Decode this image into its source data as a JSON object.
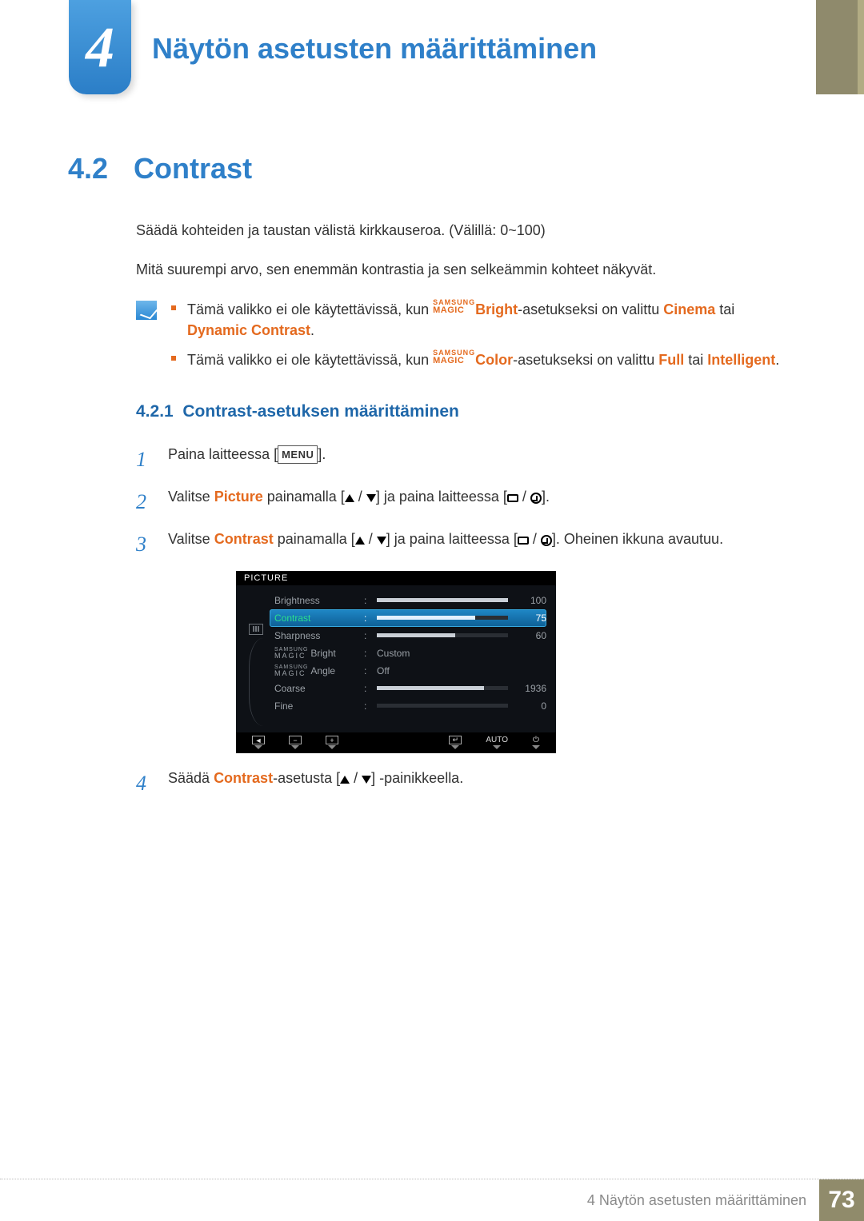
{
  "chapter": {
    "number": "4",
    "title": "Näytön asetusten määrittäminen"
  },
  "section": {
    "number": "4.2",
    "title": "Contrast"
  },
  "paragraphs": {
    "p1": "Säädä kohteiden ja taustan välistä kirkkauseroa. (Välillä: 0~100)",
    "p2": "Mitä suurempi arvo, sen enemmän kontrastia ja sen selkeämmin kohteet näkyvät."
  },
  "note": {
    "item1": {
      "pre": "Tämä valikko ei ole käytettävissä, kun ",
      "magic_top": "SAMSUNG",
      "magic_bottom": "MAGIC",
      "feature": "Bright",
      "mid": "-asetukseksi on valittu ",
      "opt1": "Cinema",
      "between": " tai ",
      "opt2": "Dynamic Contrast",
      "post": "."
    },
    "item2": {
      "pre": "Tämä valikko ei ole käytettävissä, kun ",
      "magic_top": "SAMSUNG",
      "magic_bottom": "MAGIC",
      "feature": "Color",
      "mid": "-asetukseksi on valittu ",
      "opt1": "Full",
      "between": " tai ",
      "opt2": "Intelligent",
      "post": "."
    }
  },
  "subsection": {
    "number": "4.2.1",
    "title": "Contrast-asetuksen määrittäminen"
  },
  "steps": {
    "s1": {
      "t1": "Paina laitteessa [",
      "menu": "MENU",
      "t2": "]."
    },
    "s2": {
      "t1": "Valitse ",
      "kw": "Picture",
      "t2": " painamalla [",
      "t3": "] ja paina laitteessa [",
      "t4": "]."
    },
    "s3": {
      "t1": "Valitse ",
      "kw": "Contrast",
      "t2": " painamalla [",
      "t3": "] ja paina laitteessa [",
      "t4": "]. Oheinen ikkuna avautuu."
    },
    "s4": {
      "t1": "Säädä ",
      "kw": "Contrast",
      "t2": "-asetusta [",
      "t3": "] -painikkeella."
    }
  },
  "osd": {
    "header": "PICTURE",
    "rows": {
      "brightness": {
        "label": "Brightness",
        "value": "100",
        "fill_pct": 100
      },
      "contrast": {
        "label": "Contrast",
        "value": "75",
        "fill_pct": 75
      },
      "sharpness": {
        "label": "Sharpness",
        "value": "60",
        "fill_pct": 60
      },
      "magic_bright": {
        "magic_top": "SAMSUNG",
        "magic_bottom": "MAGIC",
        "suffix": "Bright",
        "text": "Custom"
      },
      "magic_angle": {
        "magic_top": "SAMSUNG",
        "magic_bottom": "MAGIC",
        "suffix": "Angle",
        "text": "Off"
      },
      "coarse": {
        "label": "Coarse",
        "value": "1936",
        "fill_pct": 82
      },
      "fine": {
        "label": "Fine",
        "value": "0",
        "fill_pct": 0
      }
    },
    "footer": {
      "auto": "AUTO",
      "back_sym": "◄",
      "minus": "−",
      "plus": "+",
      "enter_sym": "↵",
      "power": "⏻"
    }
  },
  "footer": {
    "text": "4 Näytön asetusten määrittäminen",
    "page": "73"
  }
}
